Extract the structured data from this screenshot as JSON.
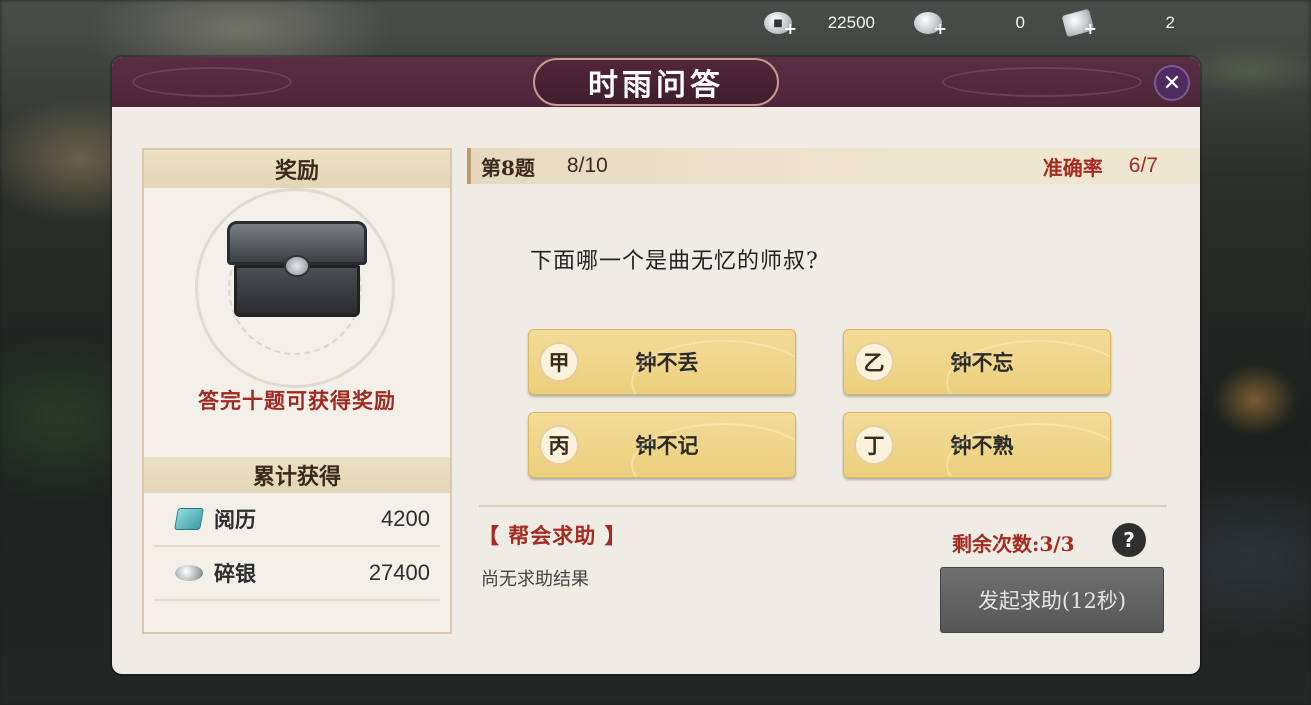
{
  "topbar": {
    "currencies": [
      {
        "icon": "silver-coin-icon",
        "value": "22500"
      },
      {
        "icon": "silver-ingot-icon",
        "value": "0"
      },
      {
        "icon": "silver-ticket-icon",
        "value": "2"
      }
    ]
  },
  "dialog": {
    "title": "时雨问答",
    "close_icon": "close-icon"
  },
  "reward": {
    "header": "奖励",
    "note": "答完十题可获得奖励",
    "accum_header": "累计获得",
    "items": [
      {
        "icon": "experience-book-icon",
        "label": "阅历",
        "value": "4200"
      },
      {
        "icon": "silver-icon",
        "label": "碎银",
        "value": "27400"
      }
    ]
  },
  "quiz": {
    "question_number": "第8题",
    "progress": "8/10",
    "accuracy_label": "准确率",
    "accuracy_value": "6/7",
    "question": "下面哪一个是曲无忆的师叔?",
    "options": [
      {
        "badge": "甲",
        "text": "钟不丢"
      },
      {
        "badge": "乙",
        "text": "钟不忘"
      },
      {
        "badge": "丙",
        "text": "钟不记"
      },
      {
        "badge": "丁",
        "text": "钟不熟"
      }
    ]
  },
  "help": {
    "title": "【 帮会求助 】",
    "result": "尚无求助结果",
    "remaining": "剩余次数:3/3",
    "question_mark": "?",
    "button_label": "发起求助(12秒)"
  },
  "colors": {
    "header_bg": "#4d2638",
    "accent_red": "#a52a22",
    "option_gold": "#eccf7d",
    "button_grey": "#5f5f5f"
  }
}
